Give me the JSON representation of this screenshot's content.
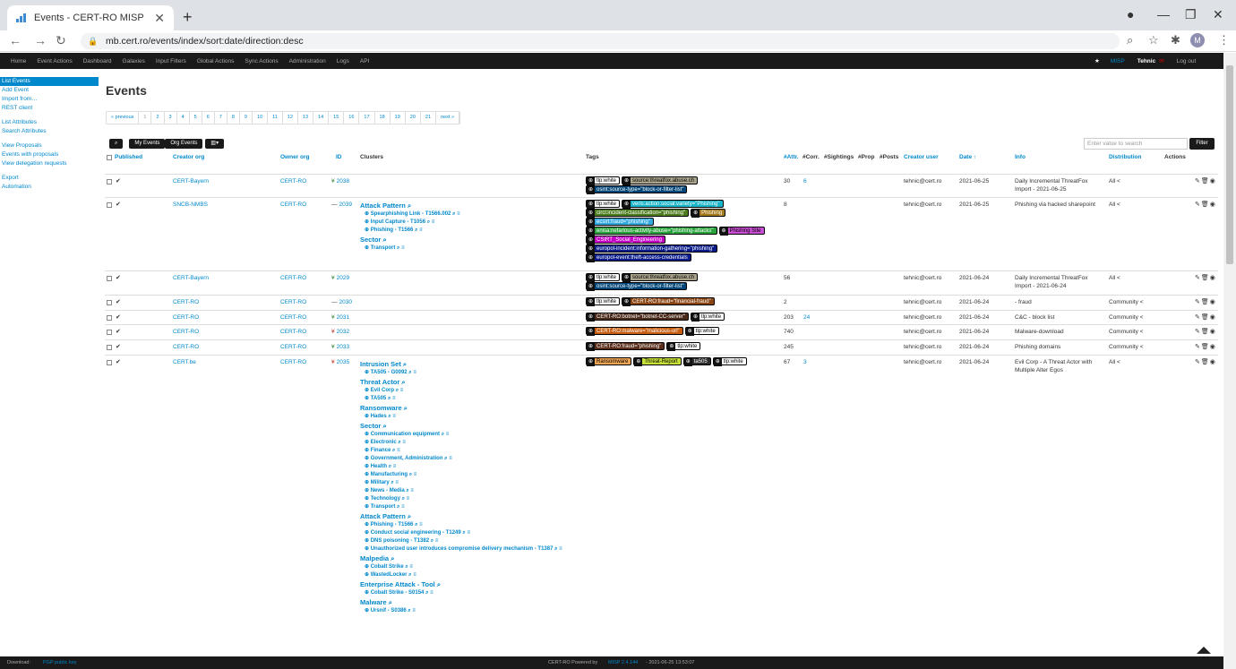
{
  "browser": {
    "tab_title": "Events - CERT-RO MISP",
    "url": "mb.cert.ro/events/index/sort:date/direction:desc",
    "avatar": "M"
  },
  "topnav": {
    "items": [
      "Home",
      "Event Actions",
      "Dashboard",
      "Galaxies",
      "Input Filters",
      "Global Actions",
      "Sync Actions",
      "Administration",
      "Logs",
      "API"
    ],
    "right": {
      "misp": "MISP",
      "user": "Tehnic",
      "logout": "Log out"
    }
  },
  "sidebar": {
    "items": [
      "List Events",
      "Add Event",
      "Import from…",
      "REST client",
      "List Attributes",
      "Search Attributes",
      "View Proposals",
      "Events with proposals",
      "View delegation requests",
      "Export",
      "Automation"
    ]
  },
  "page_title": "Events",
  "pager": {
    "prev": "« previous",
    "pages": [
      "1",
      "2",
      "3",
      "4",
      "5",
      "6",
      "7",
      "8",
      "9",
      "10",
      "11",
      "12",
      "13",
      "14",
      "15",
      "16",
      "17",
      "18",
      "19",
      "20",
      "21"
    ],
    "next": "next »"
  },
  "toolbar": {
    "my_events": "My Events",
    "org_events": "Org Events",
    "search_placeholder": "Enter value to search",
    "filter": "Filter"
  },
  "columns": {
    "published": "Published",
    "creator_org": "Creator org",
    "owner_org": "Owner org",
    "id": "ID",
    "clusters": "Clusters",
    "tags": "Tags",
    "attr": "#Attr.",
    "corr": "#Corr.",
    "sightings": "#Sightings",
    "prop": "#Prop",
    "posts": "#Posts",
    "creator_user": "Creator user",
    "date": "Date ↑",
    "info": "Info",
    "distribution": "Distribution",
    "actions": "Actions"
  },
  "rows": [
    {
      "creator": "CERT-Bayern",
      "owner": "CERT-RO",
      "id": "2038",
      "attr": "30",
      "corr": "6",
      "user": "tehnic@cert.ro",
      "date": "2021-06-25",
      "info": "Daily Incremental ThreatFox Import - 2021-06-25",
      "dist": "All"
    },
    {
      "creator": "SNCB-NMBS",
      "owner": "CERT-RO",
      "id": "2039",
      "attr": "8",
      "corr": "",
      "user": "tehnic@cert.ro",
      "date": "2021-06-25",
      "info": "Phishing via hacked sharepoint",
      "dist": "All"
    },
    {
      "creator": "CERT-Bayern",
      "owner": "CERT-RO",
      "id": "2029",
      "attr": "56",
      "corr": "",
      "user": "tehnic@cert.ro",
      "date": "2021-06-24",
      "info": "Daily Incremental ThreatFox Import - 2021-06-24",
      "dist": "All"
    },
    {
      "creator": "CERT-RO",
      "owner": "CERT-RO",
      "id": "2030",
      "attr": "2",
      "corr": "",
      "user": "tehnic@cert.ro",
      "date": "2021-06-24",
      "info": "- fraud",
      "dist": "Community"
    },
    {
      "creator": "CERT-RO",
      "owner": "CERT-RO",
      "id": "2031",
      "attr": "203",
      "corr": "24",
      "user": "tehnic@cert.ro",
      "date": "2021-06-24",
      "info": "C&C - block list",
      "dist": "Community"
    },
    {
      "creator": "CERT-RO",
      "owner": "CERT-RO",
      "id": "2032",
      "attr": "740",
      "corr": "",
      "user": "tehnic@cert.ro",
      "date": "2021-06-24",
      "info": "Malware-download",
      "dist": "Community"
    },
    {
      "creator": "CERT-RO",
      "owner": "CERT-RO",
      "id": "2033",
      "attr": "245",
      "corr": "",
      "user": "tehnic@cert.ro",
      "date": "2021-06-24",
      "info": "Phishing domains",
      "dist": "Community"
    },
    {
      "creator": "CERT.be",
      "owner": "CERT-RO",
      "id": "2035",
      "attr": "67",
      "corr": "3",
      "user": "tehnic@cert.ro",
      "date": "2021-06-24",
      "info": "Evil Corp - A Threat Actor with Multiple Alter Egos",
      "dist": "All"
    }
  ],
  "tags": {
    "r0": [
      [
        "tlp:white",
        "#ffffff",
        "#000"
      ],
      [
        "source:threatfox.abuse.ch",
        "#a8a38a",
        "#000"
      ],
      [
        "osint:source-type=\"block-or-filter-list\"",
        "#004577",
        "#fff"
      ]
    ],
    "r1": [
      [
        "tlp:white",
        "#ffffff",
        "#000"
      ],
      [
        "veris:action:social:variety=\"Phishing\"",
        "#1ab4c8",
        "#fff"
      ],
      [
        "circl:incident-classification=\"phishing\"",
        "#4d7c1f",
        "#fff"
      ],
      [
        "Phishing",
        "#a3781a",
        "#fff"
      ],
      [
        "ecsirt:fraud=\"phishing\"",
        "#33a9e0",
        "#fff"
      ],
      [
        "enisa:nefarious-activity-abuse=\"phishing-attacks\"",
        "#2aa33c",
        "#fff"
      ],
      [
        "Phishing Site",
        "#c84fd3",
        "#000"
      ],
      [
        "CSIRT_Social_Engineering",
        "#c400c4",
        "#fff"
      ],
      [
        "europol-incident:information-gathering=\"phishing\"",
        "#0a1c8a",
        "#fff"
      ],
      [
        "europol-event:theft-access-credentials",
        "#0a1c8a",
        "#fff"
      ]
    ],
    "r2": [
      [
        "tlp:white",
        "#ffffff",
        "#000"
      ],
      [
        "source:threatfox.abuse.ch",
        "#a8a38a",
        "#000"
      ],
      [
        "osint:source-type=\"block-or-filter-list\"",
        "#004577",
        "#fff"
      ]
    ],
    "r3": [
      [
        "tlp:white",
        "#ffffff",
        "#000"
      ],
      [
        "CERT-RO:fraud=\"financial-fraud\"",
        "#8b4513",
        "#fff"
      ]
    ],
    "r4": [
      [
        "CERT-RO:botnet=\"botnet-CC-server\"",
        "#4a2a1a",
        "#fff"
      ],
      [
        "tlp:white",
        "#ffffff",
        "#000"
      ]
    ],
    "r5": [
      [
        "CERT-RO:malware=\"malicious-url\"",
        "#c65d10",
        "#fff"
      ],
      [
        "tlp:white",
        "#ffffff",
        "#000"
      ]
    ],
    "r6": [
      [
        "CERT-RO:fraud=\"phishing\"",
        "#5a2e1a",
        "#fff"
      ],
      [
        "tlp:white",
        "#ffffff",
        "#000"
      ]
    ],
    "r7": [
      [
        "Ransomware",
        "#f2a654",
        "#000"
      ],
      [
        "Threat-Report",
        "#c8e03a",
        "#000"
      ],
      [
        "ta505",
        "#2c2c2c",
        "#fff"
      ],
      [
        "tlp:white",
        "#ffffff",
        "#000"
      ]
    ]
  },
  "clusters_r1": [
    {
      "head": "Attack Pattern",
      "items": [
        "Spearphishing Link - T1566.002",
        "Input Capture - T1056",
        "Phishing - T1566"
      ]
    },
    {
      "head": "Sector",
      "items": [
        "Transport"
      ]
    }
  ],
  "clusters_r7": [
    {
      "head": "Intrusion Set",
      "items": [
        "TA505 - G0092"
      ]
    },
    {
      "head": "Threat Actor",
      "items": [
        "Evil Corp",
        "TA505"
      ]
    },
    {
      "head": "Ransomware",
      "items": [
        "Hades"
      ]
    },
    {
      "head": "Sector",
      "items": [
        "Communication equipment",
        "Electronic",
        "Finance",
        "Government, Administration",
        "Health",
        "Manufacturing",
        "Military",
        "News - Media",
        "Technology",
        "Transport"
      ]
    },
    {
      "head": "Attack Pattern",
      "items": [
        "Phishing - T1566",
        "Conduct social engineering - T1249",
        "DNS poisoning - T1382",
        "Unauthorized user introduces compromise delivery mechanism - T1387"
      ]
    },
    {
      "head": "Malpedia",
      "items": [
        "Cobalt Strike",
        "WastedLocker"
      ]
    },
    {
      "head": "Enterprise Attack - Tool",
      "items": [
        "Cobalt Strike - S0154"
      ]
    },
    {
      "head": "Malware",
      "items": [
        "Ursnif - S0386"
      ]
    }
  ],
  "footer": {
    "download": "Download:",
    "pgp": "PGP public key",
    "powered": "CERT-RO Powered by",
    "misp_version": "MISP 2.4.144",
    "build_date": "- 2021-06-25 13:53:07"
  }
}
